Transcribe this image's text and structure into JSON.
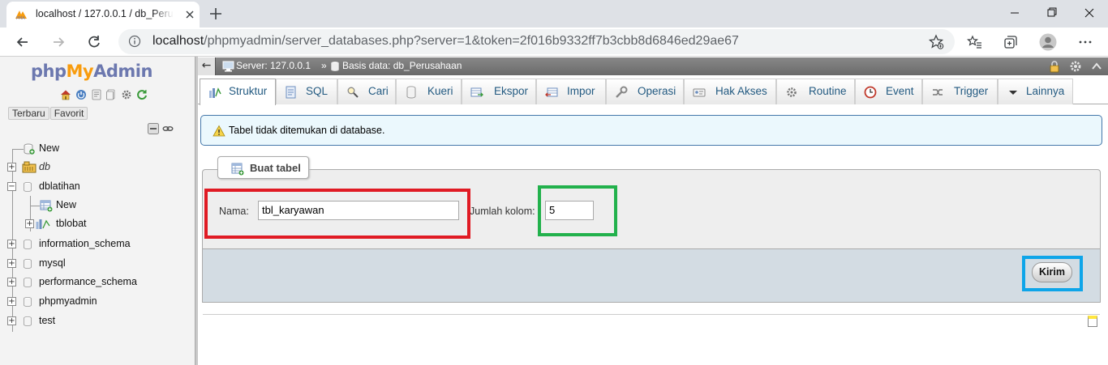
{
  "browser": {
    "tab_title": "localhost / 127.0.0.1 / db_Perusahaan",
    "url_host": "localhost",
    "url_path": "/phpmyadmin/server_databases.php?server=1&token=2f016b9332ff7b3cbb8d6846ed29ae67"
  },
  "sidebar": {
    "logo": {
      "php": "php",
      "my": "My",
      "admin": "Admin"
    },
    "recent_label": "Terbaru",
    "favorite_label": "Favorit",
    "tree": [
      {
        "label": "New",
        "level": 0
      },
      {
        "label": "db",
        "level": 0,
        "italic": true
      },
      {
        "label": "dblatihan",
        "level": 0,
        "expanded": true
      },
      {
        "label": "New",
        "level": 1
      },
      {
        "label": "tblobat",
        "level": 1
      },
      {
        "label": "information_schema",
        "level": 0
      },
      {
        "label": "mysql",
        "level": 0
      },
      {
        "label": "performance_schema",
        "level": 0
      },
      {
        "label": "phpmyadmin",
        "level": 0
      },
      {
        "label": "test",
        "level": 0
      }
    ]
  },
  "breadcrumb": {
    "server": "Server: 127.0.0.1",
    "separator": "»",
    "database": "Basis data: db_Perusahaan"
  },
  "menu": {
    "tabs": [
      "Struktur",
      "SQL",
      "Cari",
      "Kueri",
      "Ekspor",
      "Impor",
      "Operasi",
      "Hak Akses",
      "Routine",
      "Event",
      "Trigger",
      "Lainnya"
    ],
    "active": "Struktur"
  },
  "notice": {
    "text": "Tabel tidak ditemukan di database."
  },
  "create_table": {
    "legend": "Buat tabel",
    "name_label": "Nama:",
    "name_value": "tbl_karyawan",
    "columns_label": "Jumlah kolom:",
    "columns_value": "5",
    "submit_label": "Kirim"
  },
  "colors": {
    "highlight_red": "#e01b24",
    "highlight_green": "#22b14c",
    "highlight_blue": "#0ea5e9",
    "link_blue": "#235a81"
  }
}
